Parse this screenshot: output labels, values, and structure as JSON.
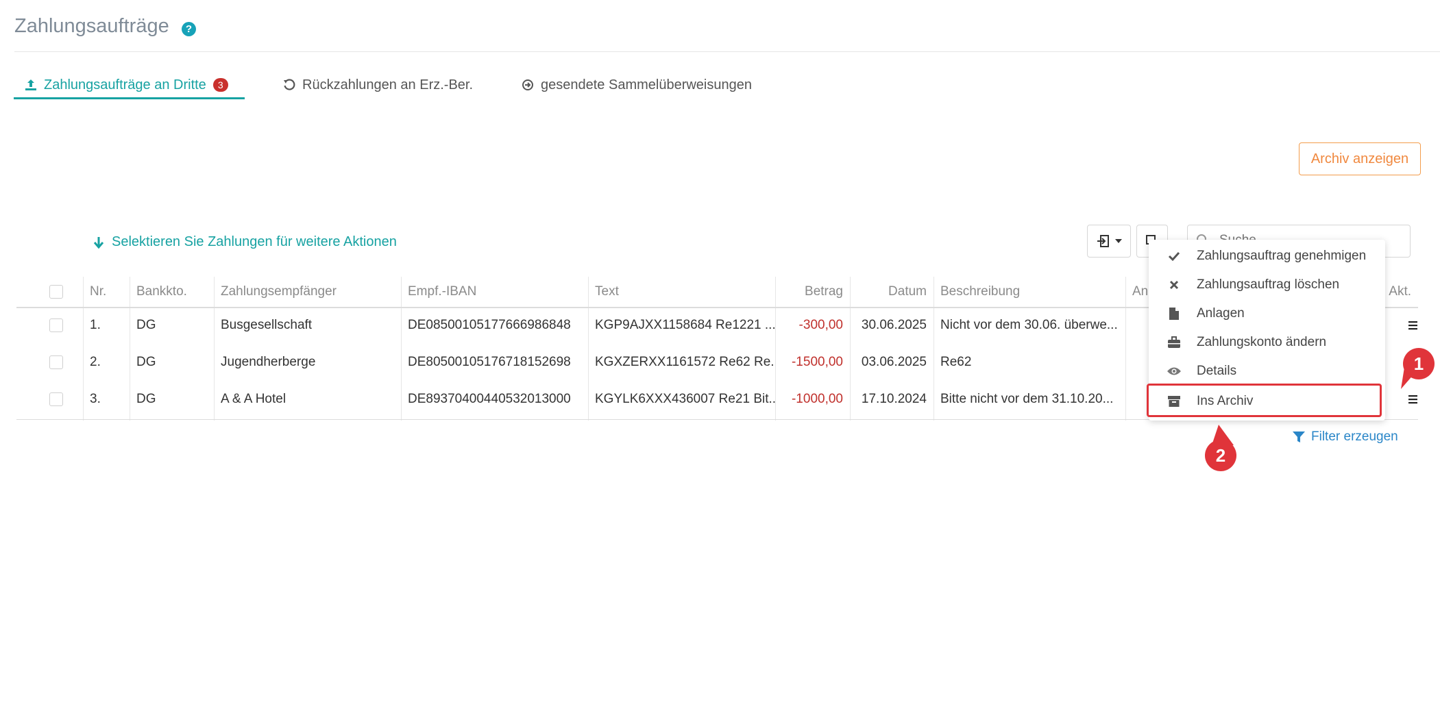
{
  "header": {
    "title": "Zahlungsaufträge",
    "help_glyph": "?"
  },
  "tabs": [
    {
      "label": "Zahlungsaufträge an Dritte",
      "badge": "3",
      "icon": "upload-icon",
      "active": true
    },
    {
      "label": "Rückzahlungen an Erz.-Ber.",
      "icon": "undo-icon",
      "active": false
    },
    {
      "label": "gesendete Sammelüberweisungen",
      "icon": "circle-arrow-right-icon",
      "active": false
    }
  ],
  "archive_button": {
    "label": "Archiv anzeigen"
  },
  "selection_hint": {
    "label": "Selektieren Sie Zahlungen für weitere Aktionen"
  },
  "search": {
    "placeholder": "Suche"
  },
  "table": {
    "headers": [
      "Nr.",
      "Bankkto.",
      "Zahlungsempfänger",
      "Empf.-IBAN",
      "Text",
      "Betrag",
      "Datum",
      "Beschreibung",
      "An",
      "Akt."
    ],
    "rows": [
      {
        "nr": "1.",
        "bank": "DG",
        "recipient": "Busgesellschaft",
        "iban": "DE08500105177666986848",
        "text": "KGP9AJXX1158684 Re1221 ...",
        "amount": "-300,00",
        "date": "30.06.2025",
        "description": "Nicht vor dem 30.06. überwe..."
      },
      {
        "nr": "2.",
        "bank": "DG",
        "recipient": "Jugendherberge",
        "iban": "DE80500105176718152698",
        "text": "KGXZERXX1161572 Re62 Re...",
        "amount": "-1500,00",
        "date": "03.06.2025",
        "description": "Re62"
      },
      {
        "nr": "3.",
        "bank": "DG",
        "recipient": "A & A Hotel",
        "iban": "DE89370400440532013000",
        "text": "KGYLK6XXX436007 Re21 Bit...",
        "amount": "-1000,00",
        "date": "17.10.2024",
        "description": "Bitte nicht vor dem 31.10.20..."
      }
    ]
  },
  "dropdown": {
    "items": [
      {
        "label": "Zahlungsauftrag genehmigen",
        "icon": "check-icon"
      },
      {
        "label": "Zahlungsauftrag löschen",
        "icon": "times-icon"
      },
      {
        "label": "Anlagen",
        "icon": "file-icon"
      },
      {
        "label": "Zahlungskonto ändern",
        "icon": "briefcase-icon"
      },
      {
        "label": "Details",
        "icon": "eye-icon"
      },
      {
        "label": "Ins Archiv",
        "icon": "archive-icon"
      }
    ]
  },
  "filter_link": {
    "label": "Filter erzeugen"
  },
  "callouts": [
    "1",
    "2"
  ],
  "colors": {
    "accent": "#17a2a2",
    "orange": "#f0883e",
    "negative": "#c0302c",
    "callout": "#e0343a"
  }
}
